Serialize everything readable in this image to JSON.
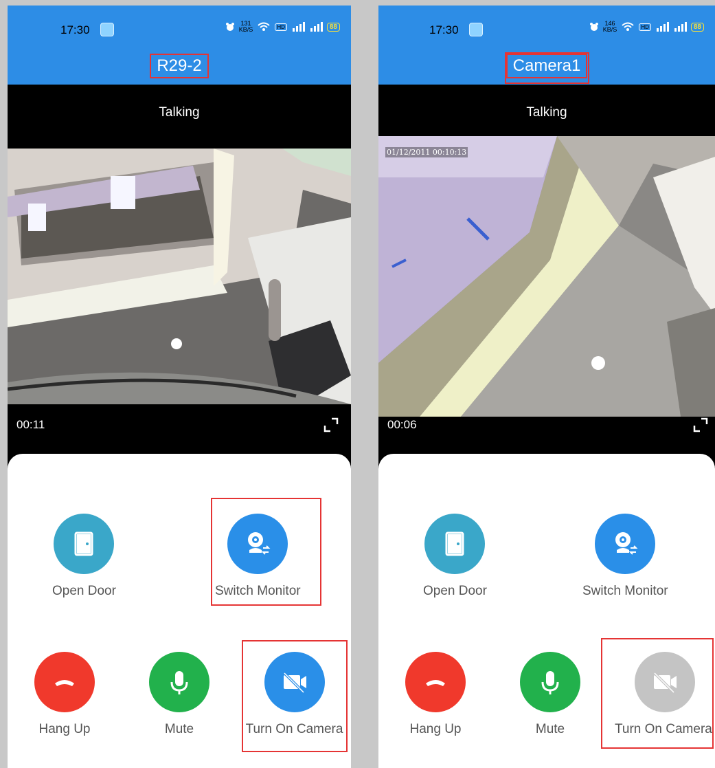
{
  "left": {
    "status": {
      "time": "17:30",
      "net_speed": "131",
      "net_unit": "KB/S",
      "hd": "HD",
      "battery": "88"
    },
    "title": "R29-2",
    "call_state": "Talking",
    "timer": "00:11",
    "actions": {
      "open_door": "Open Door",
      "switch_monitor": "Switch Monitor",
      "hang_up": "Hang Up",
      "mute": "Mute",
      "camera": "Turn On Camera"
    }
  },
  "right": {
    "status": {
      "time": "17:30",
      "net_speed": "146",
      "net_unit": "KB/S",
      "hd": "HD",
      "battery": "88"
    },
    "title": "Camera1",
    "call_state": "Talking",
    "osd": "01/12/2011 00:10:13",
    "timer": "00:06",
    "actions": {
      "open_door": "Open Door",
      "switch_monitor": "Switch Monitor",
      "hang_up": "Hang Up",
      "mute": "Mute",
      "camera": "Turn On Camera"
    }
  },
  "colors": {
    "header": "#2d8de6",
    "open_door": "#3aa7c9",
    "switch_monitor": "#2a8fe8",
    "hang_up": "#f0392c",
    "mute": "#22b14c",
    "camera_on": "#2a8fe8",
    "camera_disabled": "#c4c4c4",
    "highlight": "#e53434"
  }
}
